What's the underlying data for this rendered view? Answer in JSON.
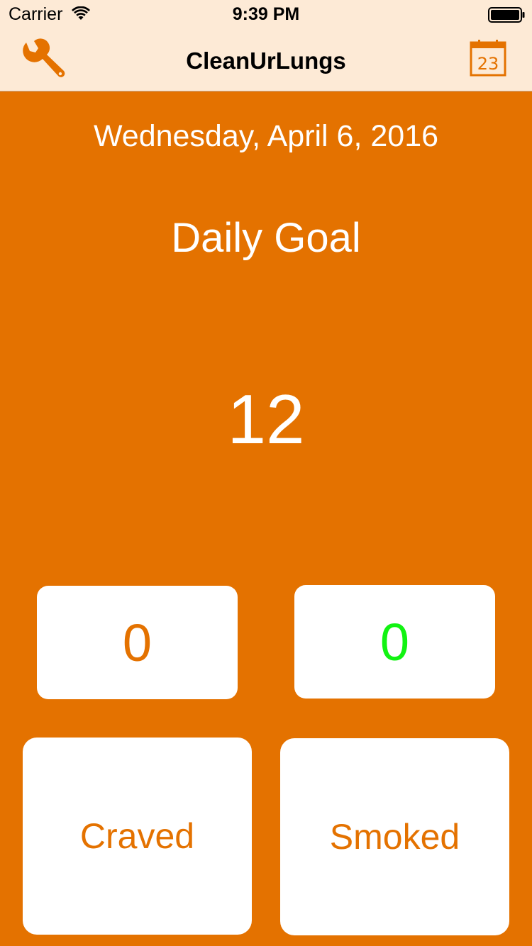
{
  "status_bar": {
    "carrier": "Carrier",
    "time": "9:39 PM"
  },
  "nav": {
    "title": "CleanUrLungs",
    "settings_icon": "wrench-icon",
    "calendar_icon": "calendar-icon",
    "calendar_day": "23"
  },
  "main": {
    "date": "Wednesday, April 6, 2016",
    "goal_title": "Daily Goal",
    "goal_value": "12"
  },
  "counters": {
    "craved": "0",
    "smoked": "0"
  },
  "buttons": {
    "craved_label": "Craved",
    "smoked_label": "Smoked"
  },
  "colors": {
    "background": "#E47200",
    "nav_background": "#FDEAD6",
    "accent": "#E47200",
    "smoked_count": "#12F312"
  }
}
